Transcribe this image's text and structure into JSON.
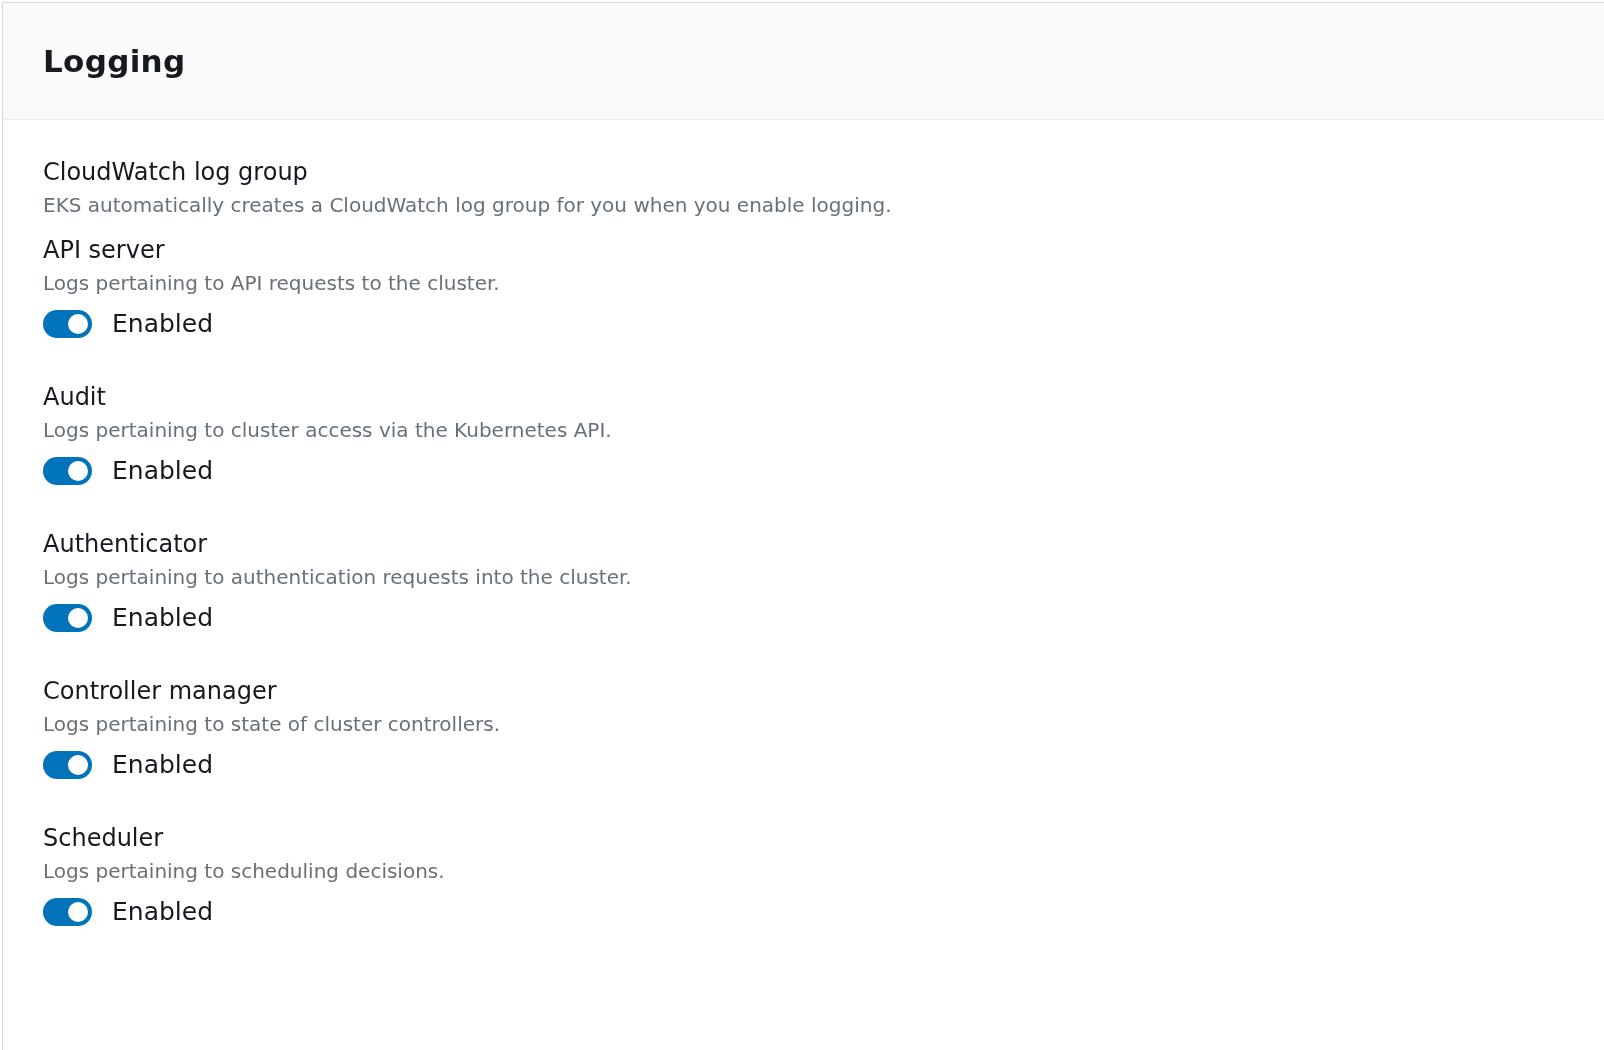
{
  "panel": {
    "title": "Logging"
  },
  "log_group": {
    "title": "CloudWatch log group",
    "description": "EKS automatically creates a CloudWatch log group for you when you enable logging."
  },
  "log_types": [
    {
      "name": "API server",
      "description": "Logs pertaining to API requests to the cluster.",
      "on": true,
      "label": "Enabled"
    },
    {
      "name": "Audit",
      "description": "Logs pertaining to cluster access via the Kubernetes API.",
      "on": true,
      "label": "Enabled"
    },
    {
      "name": "Authenticator",
      "description": "Logs pertaining to authentication requests into the cluster.",
      "on": true,
      "label": "Enabled"
    },
    {
      "name": "Controller manager",
      "description": "Logs pertaining to state of cluster controllers.",
      "on": true,
      "label": "Enabled"
    },
    {
      "name": "Scheduler",
      "description": "Logs pertaining to scheduling decisions.",
      "on": true,
      "label": "Enabled"
    }
  ]
}
